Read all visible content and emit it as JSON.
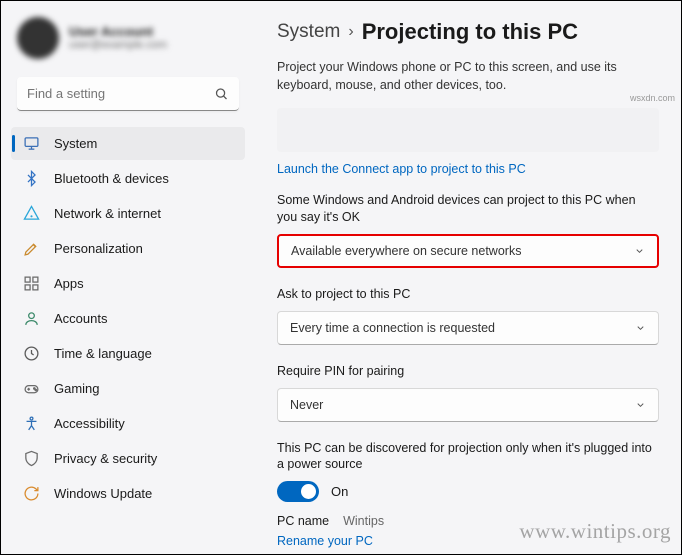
{
  "profile": {
    "name": "User Account",
    "sub": "user@example.com"
  },
  "search": {
    "placeholder": "Find a setting"
  },
  "nav": [
    {
      "label": "System",
      "icon": "system",
      "color": "#3b6fb6",
      "selected": true
    },
    {
      "label": "Bluetooth & devices",
      "icon": "bluetooth",
      "color": "#3373c4"
    },
    {
      "label": "Network & internet",
      "icon": "network",
      "color": "#2aa6d9"
    },
    {
      "label": "Personalization",
      "icon": "personalization",
      "color": "#c98a2e"
    },
    {
      "label": "Apps",
      "icon": "apps",
      "color": "#6b6b6b"
    },
    {
      "label": "Accounts",
      "icon": "accounts",
      "color": "#3d8a6b"
    },
    {
      "label": "Time & language",
      "icon": "time",
      "color": "#5a5a5a"
    },
    {
      "label": "Gaming",
      "icon": "gaming",
      "color": "#6b6b6b"
    },
    {
      "label": "Accessibility",
      "icon": "accessibility",
      "color": "#2e6fb6"
    },
    {
      "label": "Privacy & security",
      "icon": "privacy",
      "color": "#6b6b6b"
    },
    {
      "label": "Windows Update",
      "icon": "update",
      "color": "#d98b2e"
    }
  ],
  "breadcrumb": {
    "parent": "System",
    "sep": "›",
    "current": "Projecting to this PC"
  },
  "description": "Project your Windows phone or PC to this screen, and use its keyboard, mouse, and other devices, too.",
  "launch_link": "Launch the Connect app to project to this PC",
  "setting1": {
    "label": "Some Windows and Android devices can project to this PC when you say it's OK",
    "value": "Available everywhere on secure networks"
  },
  "setting2": {
    "label": "Ask to project to this PC",
    "value": "Every time a connection is requested"
  },
  "setting3": {
    "label": "Require PIN for pairing",
    "value": "Never"
  },
  "discover": {
    "label": "This PC can be discovered for projection only when it's plugged into a power source",
    "toggle_label": "On"
  },
  "pcname": {
    "label": "PC name",
    "value": "Wintips"
  },
  "rename_link": "Rename your PC",
  "watermark": "www.wintips.org",
  "source": "wsxdn.com"
}
